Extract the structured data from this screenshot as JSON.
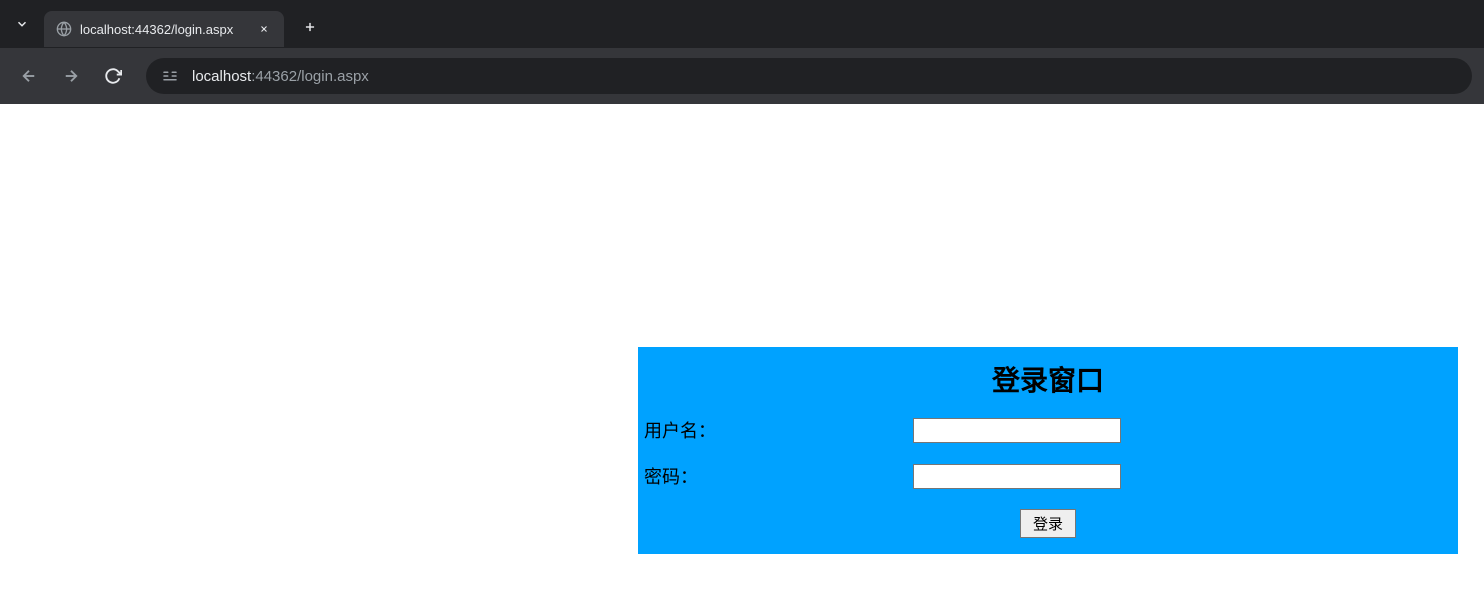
{
  "browser": {
    "tab_title": "localhost:44362/login.aspx",
    "url_host": "localhost",
    "url_port_path": ":44362/login.aspx"
  },
  "login": {
    "title": "登录窗口",
    "username_label": "用户名：",
    "password_label": "密码：",
    "button_label": "登录",
    "username_value": "",
    "password_value": ""
  }
}
